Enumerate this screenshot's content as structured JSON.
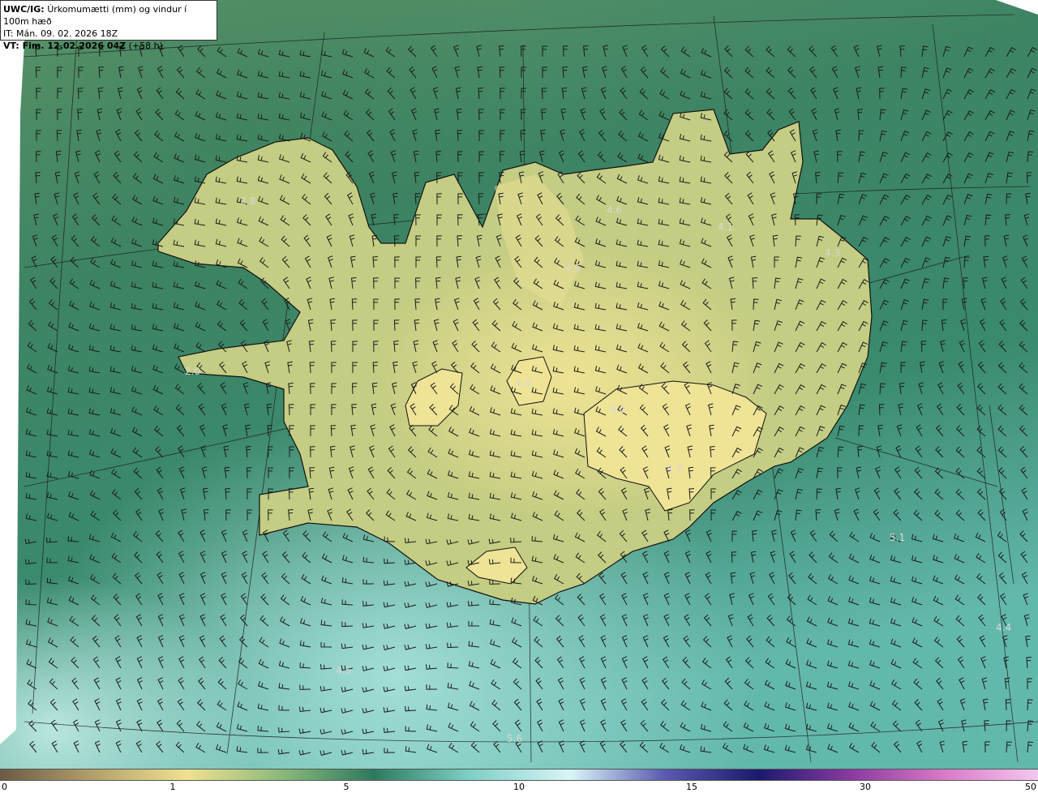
{
  "header": {
    "model": "UWC/IG:",
    "parameter": "Úrkomumætti (mm) og vindur í 100m hæð",
    "issue_time": "IT: Mán. 09. 02. 2026 18Z",
    "valid_prefix": "VT: Fim. 12.02.2026 04Z",
    "valid_offset": "(+58 h)"
  },
  "map_values": [
    "2.8",
    "4.6",
    "4.1",
    "4.3",
    "4.5",
    "2.0",
    "4.0",
    "0.0",
    "4.7",
    "5.1",
    "4.4",
    "4.5",
    "5.6"
  ],
  "colorbar": {
    "ticks": [
      "0",
      "1",
      "5",
      "10",
      "15",
      "30",
      "50"
    ],
    "colors": [
      "#6b5b45",
      "#b3a06b",
      "#efe28f",
      "#8cba7a",
      "#2d7a5e",
      "#7bcfc2",
      "#d9f5f8",
      "#5a5ab0",
      "#1a1a6e",
      "#8a3aa0",
      "#d97ac8",
      "#f3c8ee"
    ]
  },
  "colors": {
    "sea_deep": "#2e7a5f",
    "sea_light": "#a6e0dc",
    "land": "#c8cf84",
    "land_high": "#ece494"
  }
}
